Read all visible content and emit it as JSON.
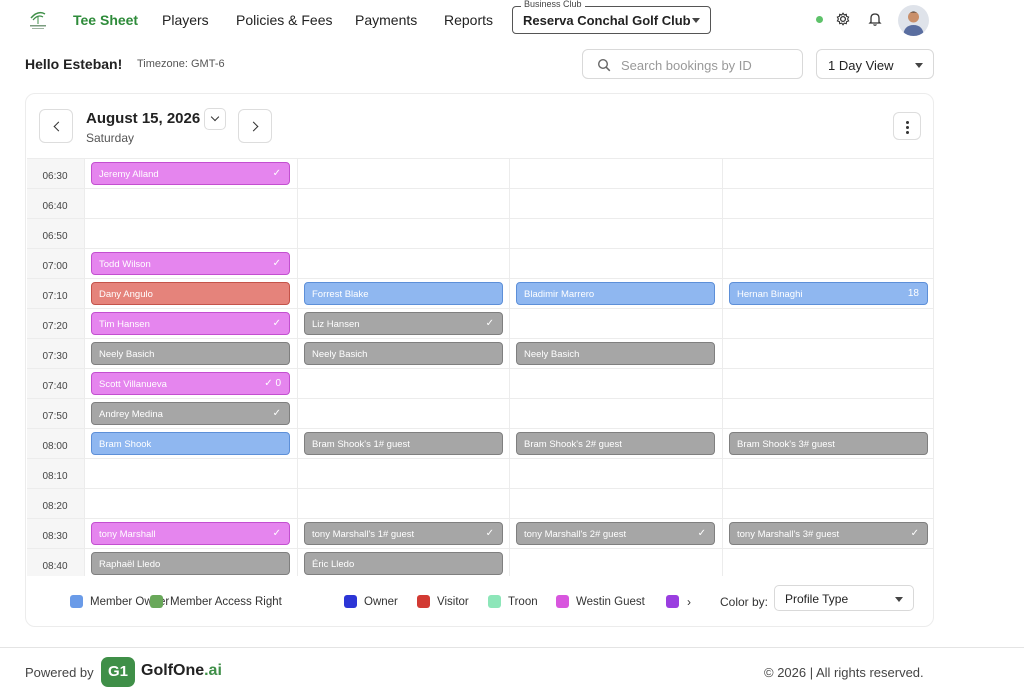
{
  "nav": {
    "items": [
      "Tee Sheet",
      "Players",
      "Policies & Fees",
      "Payments",
      "Reports"
    ],
    "active": "Tee Sheet",
    "club_label": "Business Club",
    "club_value": "Reserva Conchal Golf Club"
  },
  "header": {
    "greeting": "Hello Esteban!",
    "timezone": "Timezone: GMT-6",
    "search_placeholder": "Search bookings by ID",
    "view": "1 Day View"
  },
  "calendar": {
    "date": "August 15, 2026",
    "weekday": "Saturday",
    "times": [
      "06:30",
      "06:40",
      "06:50",
      "07:00",
      "07:10",
      "07:20",
      "07:30",
      "07:40",
      "07:50",
      "08:00",
      "08:10",
      "08:20",
      "08:30",
      "08:40"
    ],
    "bookings": [
      {
        "row": 0,
        "col": 0,
        "name": "Jeremy Alland",
        "color": "pink",
        "mark": "✓"
      },
      {
        "row": 3,
        "col": 0,
        "name": "Todd Wilson",
        "color": "pink",
        "mark": "✓"
      },
      {
        "row": 4,
        "col": 0,
        "name": "Dany Angulo",
        "color": "red",
        "mark": ""
      },
      {
        "row": 4,
        "col": 1,
        "name": "Forrest Blake",
        "color": "blue",
        "mark": ""
      },
      {
        "row": 4,
        "col": 2,
        "name": "Bladimir Marrero",
        "color": "blue",
        "mark": ""
      },
      {
        "row": 4,
        "col": 3,
        "name": "Hernan Binaghi",
        "color": "blue",
        "mark": "18"
      },
      {
        "row": 5,
        "col": 0,
        "name": "Tim Hansen",
        "color": "pink",
        "mark": "✓"
      },
      {
        "row": 5,
        "col": 1,
        "name": "Liz Hansen",
        "color": "gray",
        "mark": "✓"
      },
      {
        "row": 6,
        "col": 0,
        "name": "Neely Basich",
        "color": "gray",
        "mark": ""
      },
      {
        "row": 6,
        "col": 1,
        "name": "Neely Basich",
        "color": "gray",
        "mark": ""
      },
      {
        "row": 6,
        "col": 2,
        "name": "Neely Basich",
        "color": "gray",
        "mark": ""
      },
      {
        "row": 7,
        "col": 0,
        "name": "Scott Villanueva",
        "color": "pink",
        "mark": "✓ 0"
      },
      {
        "row": 8,
        "col": 0,
        "name": "Andrey Medina",
        "color": "gray",
        "mark": "✓"
      },
      {
        "row": 9,
        "col": 0,
        "name": "Bram Shook",
        "color": "blue",
        "mark": ""
      },
      {
        "row": 9,
        "col": 1,
        "name": "Bram Shook's 1# guest",
        "color": "gray",
        "mark": ""
      },
      {
        "row": 9,
        "col": 2,
        "name": "Bram Shook's 2# guest",
        "color": "gray",
        "mark": ""
      },
      {
        "row": 9,
        "col": 3,
        "name": "Bram Shook's 3# guest",
        "color": "gray",
        "mark": ""
      },
      {
        "row": 12,
        "col": 0,
        "name": "tony Marshall",
        "color": "pink",
        "mark": "✓"
      },
      {
        "row": 12,
        "col": 1,
        "name": "tony Marshall's 1# guest",
        "color": "gray",
        "mark": "✓"
      },
      {
        "row": 12,
        "col": 2,
        "name": "tony Marshall's 2# guest",
        "color": "gray",
        "mark": "✓"
      },
      {
        "row": 12,
        "col": 3,
        "name": "tony Marshall's 3# guest",
        "color": "gray",
        "mark": "✓"
      },
      {
        "row": 13,
        "col": 0,
        "name": "Raphaël Lledo",
        "color": "gray",
        "mark": ""
      },
      {
        "row": 13,
        "col": 1,
        "name": "Éric Lledo",
        "color": "gray",
        "mark": ""
      }
    ]
  },
  "legend": {
    "items": [
      {
        "label": "Member Owner",
        "color": "#6a9be8"
      },
      {
        "label": "Member Access Right",
        "color": "#69a85a"
      },
      {
        "label": "Owner",
        "color": "#2c35d6"
      },
      {
        "label": "Visitor",
        "color": "#d23a33"
      },
      {
        "label": "Troon",
        "color": "#8de6b9"
      },
      {
        "label": "Westin Guest",
        "color": "#d856de"
      },
      {
        "label": "",
        "color": "#9a3ee0"
      }
    ],
    "more": "›",
    "color_by_label": "Color by:",
    "color_by_value": "Profile Type"
  },
  "footer": {
    "powered": "Powered by",
    "logo_mark": "G1",
    "brand_main": "GolfOne",
    "brand_suffix": ".ai",
    "copyright": "© 2026 | All rights reserved."
  }
}
